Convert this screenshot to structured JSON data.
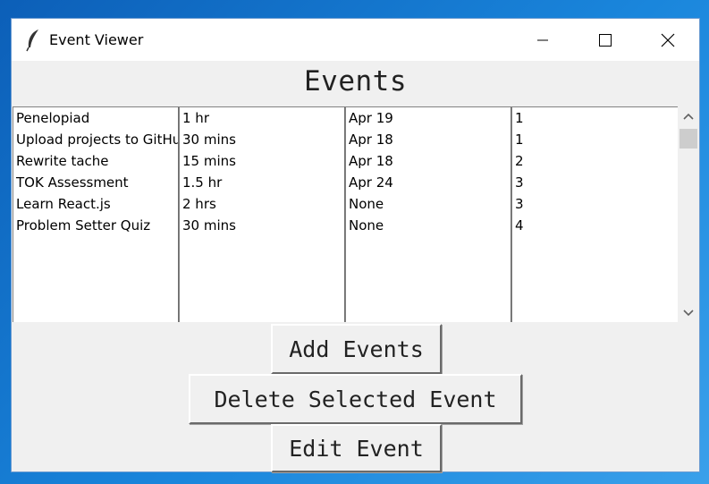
{
  "window": {
    "title": "Event Viewer"
  },
  "main": {
    "heading": "Events"
  },
  "columns": {
    "names": [
      "Penelopiad",
      "Upload projects to GitHub",
      "Rewrite tache",
      "TOK Assessment",
      "Learn React.js",
      "Problem Setter Quiz"
    ],
    "durations": [
      "1 hr",
      "30 mins",
      "15 mins",
      "1.5 hr",
      "2 hrs",
      "30 mins"
    ],
    "dates": [
      "Apr 19",
      "Apr 18",
      "Apr 18",
      "Apr 24",
      "None",
      "None"
    ],
    "priorities": [
      "1",
      "1",
      "2",
      "3",
      "3",
      "4"
    ]
  },
  "buttons": {
    "add": "Add Events",
    "delete": "Delete Selected Event",
    "edit": "Edit Event"
  }
}
